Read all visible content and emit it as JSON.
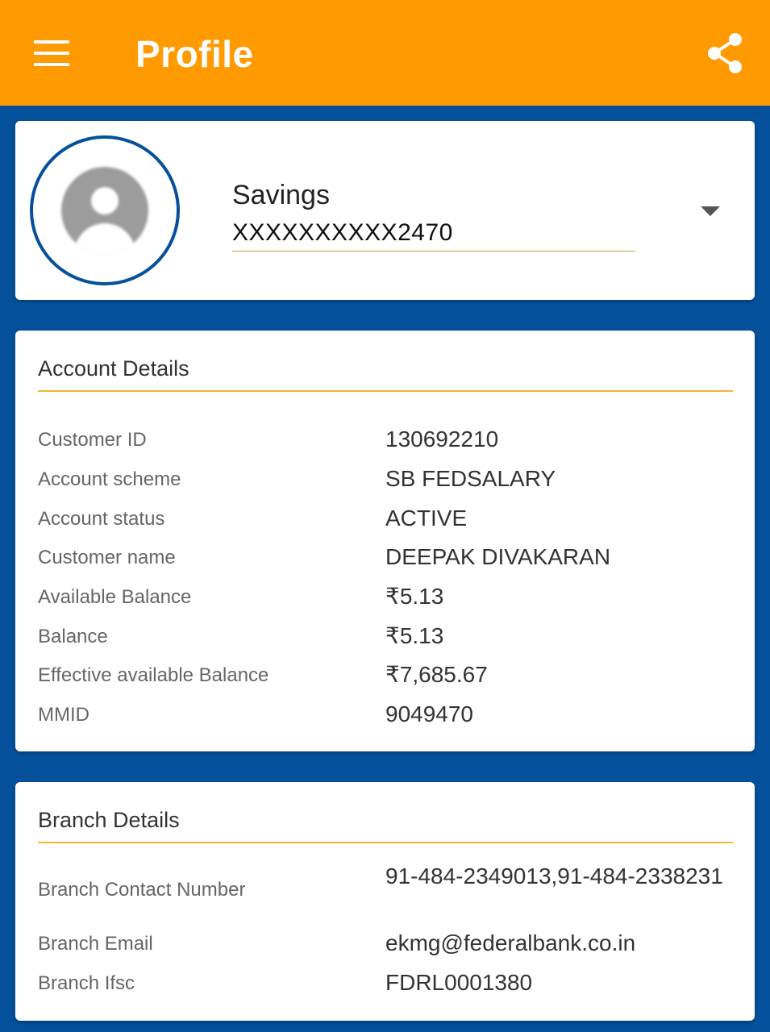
{
  "appbar": {
    "title": "Profile",
    "menu_icon": "hamburger-menu-icon",
    "share_icon": "share-icon",
    "color": "#ff9a00"
  },
  "account": {
    "type": "Savings",
    "number": "XXXXXXXXXX2470",
    "avatar_icon": "user-avatar-icon",
    "dropdown_icon": "caret-down-icon"
  },
  "account_details": {
    "title": "Account Details",
    "rows": [
      {
        "label": "Customer ID",
        "value": "130692210"
      },
      {
        "label": "Account scheme",
        "value": "SB FEDSALARY"
      },
      {
        "label": "Account status",
        "value": "ACTIVE"
      },
      {
        "label": "Customer name",
        "value": "DEEPAK DIVAKARAN"
      },
      {
        "label": "Available Balance",
        "value": "₹5.13"
      },
      {
        "label": "Balance",
        "value": "₹5.13"
      },
      {
        "label": "Effective available Balance",
        "value": "₹7,685.67"
      },
      {
        "label": "MMID",
        "value": "9049470"
      }
    ]
  },
  "branch_details": {
    "title": "Branch Details",
    "rows": [
      {
        "label": "Branch Contact Number",
        "value": "91-484-2349013,91-484-2338231"
      },
      {
        "label": "Branch Email",
        "value": "ekmg@federalbank.co.in"
      },
      {
        "label": "Branch Ifsc",
        "value": "FDRL0001380"
      }
    ]
  },
  "colors": {
    "background": "#05509a",
    "accent_rule": "#f2b632"
  }
}
